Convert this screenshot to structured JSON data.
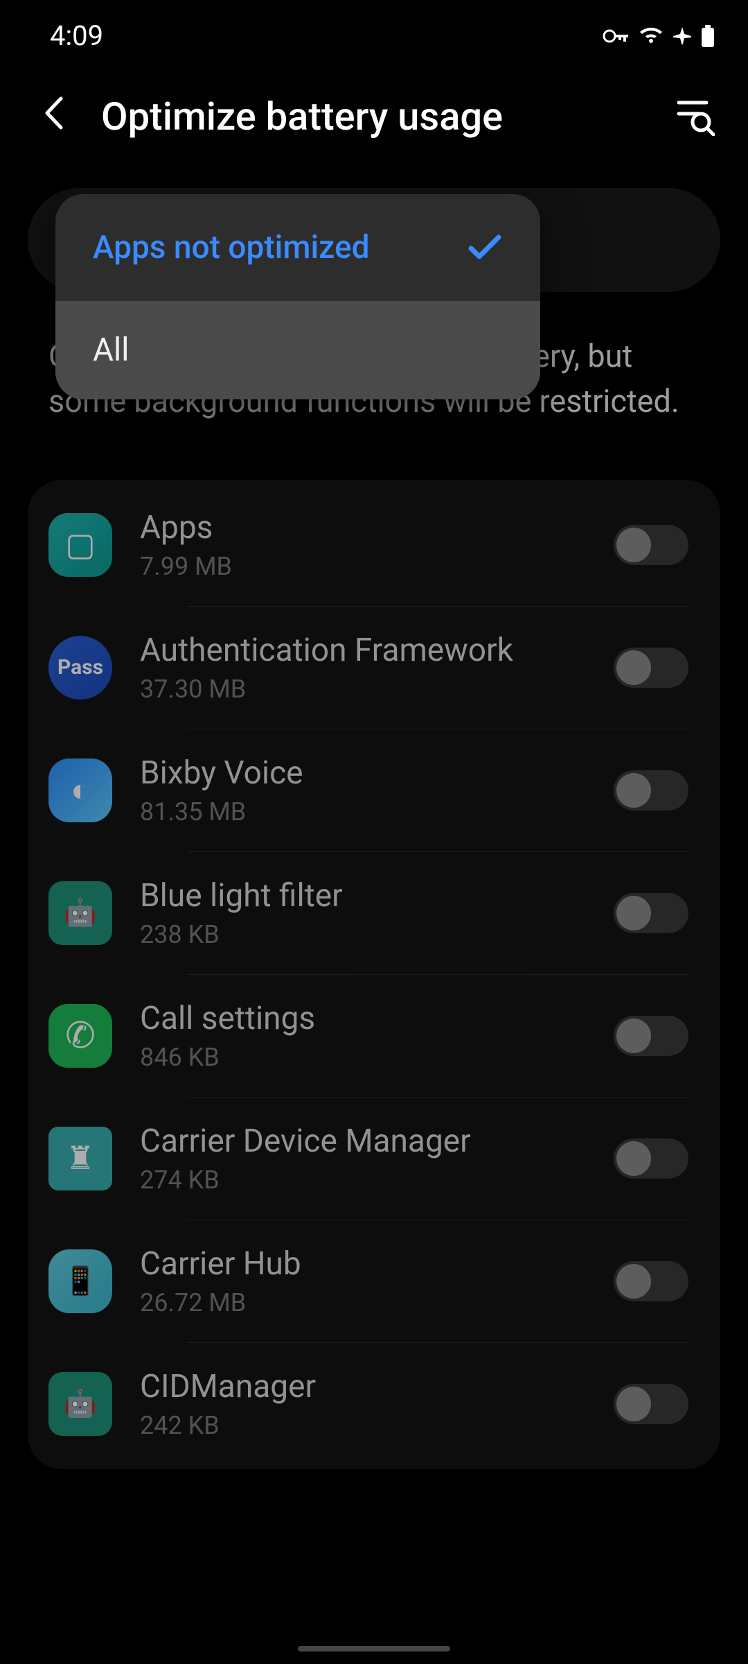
{
  "status": {
    "time": "4:09",
    "icons": [
      "vpn-key-icon",
      "wifi-icon",
      "airplane-icon",
      "battery-icon"
    ]
  },
  "header": {
    "title": "Optimize battery usage"
  },
  "filter": {
    "selected_label": "Apps not optimized",
    "options": [
      {
        "label": "Apps not optimized",
        "selected": true
      },
      {
        "label": "All",
        "selected": false
      }
    ]
  },
  "description": "Optimized apps will save more battery, but some background functions will be restricted.",
  "apps": [
    {
      "name": "Apps",
      "size": "7.99 MB",
      "icon": "ic-apps",
      "glyph": "▢",
      "toggled": false
    },
    {
      "name": "Authentication Framework",
      "size": "37.30 MB",
      "icon": "ic-pass",
      "glyph": "Pass",
      "toggled": false
    },
    {
      "name": "Bixby Voice",
      "size": "81.35 MB",
      "icon": "ic-bixby",
      "glyph": "◐",
      "toggled": false
    },
    {
      "name": "Blue light filter",
      "size": "238 KB",
      "icon": "ic-blf",
      "glyph": "🤖",
      "toggled": false
    },
    {
      "name": "Call settings",
      "size": "846 KB",
      "icon": "ic-call",
      "glyph": "✆",
      "toggled": false
    },
    {
      "name": "Carrier Device Manager",
      "size": "274 KB",
      "icon": "ic-cdm",
      "glyph": "♜",
      "toggled": false
    },
    {
      "name": "Carrier Hub",
      "size": "26.72 MB",
      "icon": "ic-chub",
      "glyph": "📱",
      "toggled": false
    },
    {
      "name": "CIDManager",
      "size": "242 KB",
      "icon": "ic-cid",
      "glyph": "🤖",
      "toggled": false
    }
  ]
}
